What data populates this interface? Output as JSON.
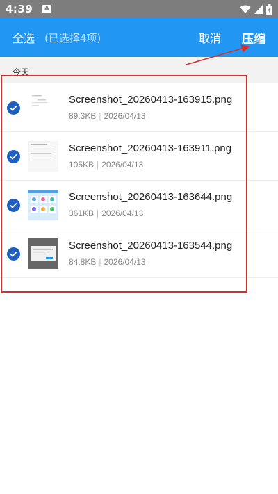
{
  "status_bar": {
    "time": "4:39",
    "notification_icon_letter": "A",
    "icons": [
      "wifi-icon",
      "signal-icon",
      "battery-icon"
    ]
  },
  "toolbar": {
    "select_all_label": "全选",
    "selected_count_label": "(已选择4项)",
    "cancel_label": "取消",
    "compress_label": "压缩"
  },
  "section": {
    "label": "今天"
  },
  "files": [
    {
      "name": "Screenshot_20260413-163915.png",
      "size": "89.3KB",
      "date": "2026/04/13",
      "checked": true
    },
    {
      "name": "Screenshot_20260413-163911.png",
      "size": "105KB",
      "date": "2026/04/13",
      "checked": true
    },
    {
      "name": "Screenshot_20260413-163644.png",
      "size": "361KB",
      "date": "2026/04/13",
      "checked": true
    },
    {
      "name": "Screenshot_20260413-163544.png",
      "size": "84.8KB",
      "date": "2026/04/13",
      "checked": true
    }
  ],
  "colors": {
    "appbar": "#2196f3",
    "check": "#1f5fbf",
    "annotation": "#d32f2f"
  }
}
